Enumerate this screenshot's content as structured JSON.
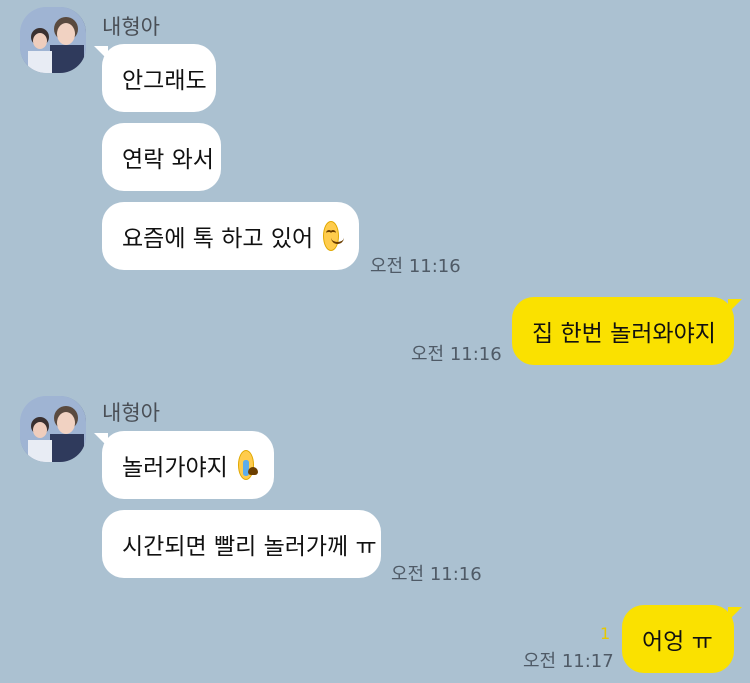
{
  "theme": {
    "background": "#abc1d1",
    "incoming_bubble": "#ffffff",
    "outgoing_bubble": "#fae100",
    "unread_color": "#e6c800"
  },
  "groups": [
    {
      "sender": "내형아",
      "messages": [
        {
          "text": "안그래도"
        },
        {
          "text": "연락 와서"
        },
        {
          "text": "요즘에 톡 하고 있어",
          "emoji": "smiling-face-emoji"
        }
      ],
      "time": "오전 11:16"
    },
    {
      "outgoing": true,
      "messages": [
        {
          "text": "집 한번 놀러와야지"
        }
      ],
      "time": "오전 11:16"
    },
    {
      "sender": "내형아",
      "messages": [
        {
          "text": "놀러가야지",
          "emoji": "loudly-crying-face-emoji"
        },
        {
          "text": "시간되면 빨리 놀러가께 ㅠ"
        }
      ],
      "time": "오전 11:16"
    },
    {
      "outgoing": true,
      "messages": [
        {
          "text": "어엉 ㅠ"
        }
      ],
      "time": "오전 11:17",
      "unread_count": "1"
    }
  ]
}
